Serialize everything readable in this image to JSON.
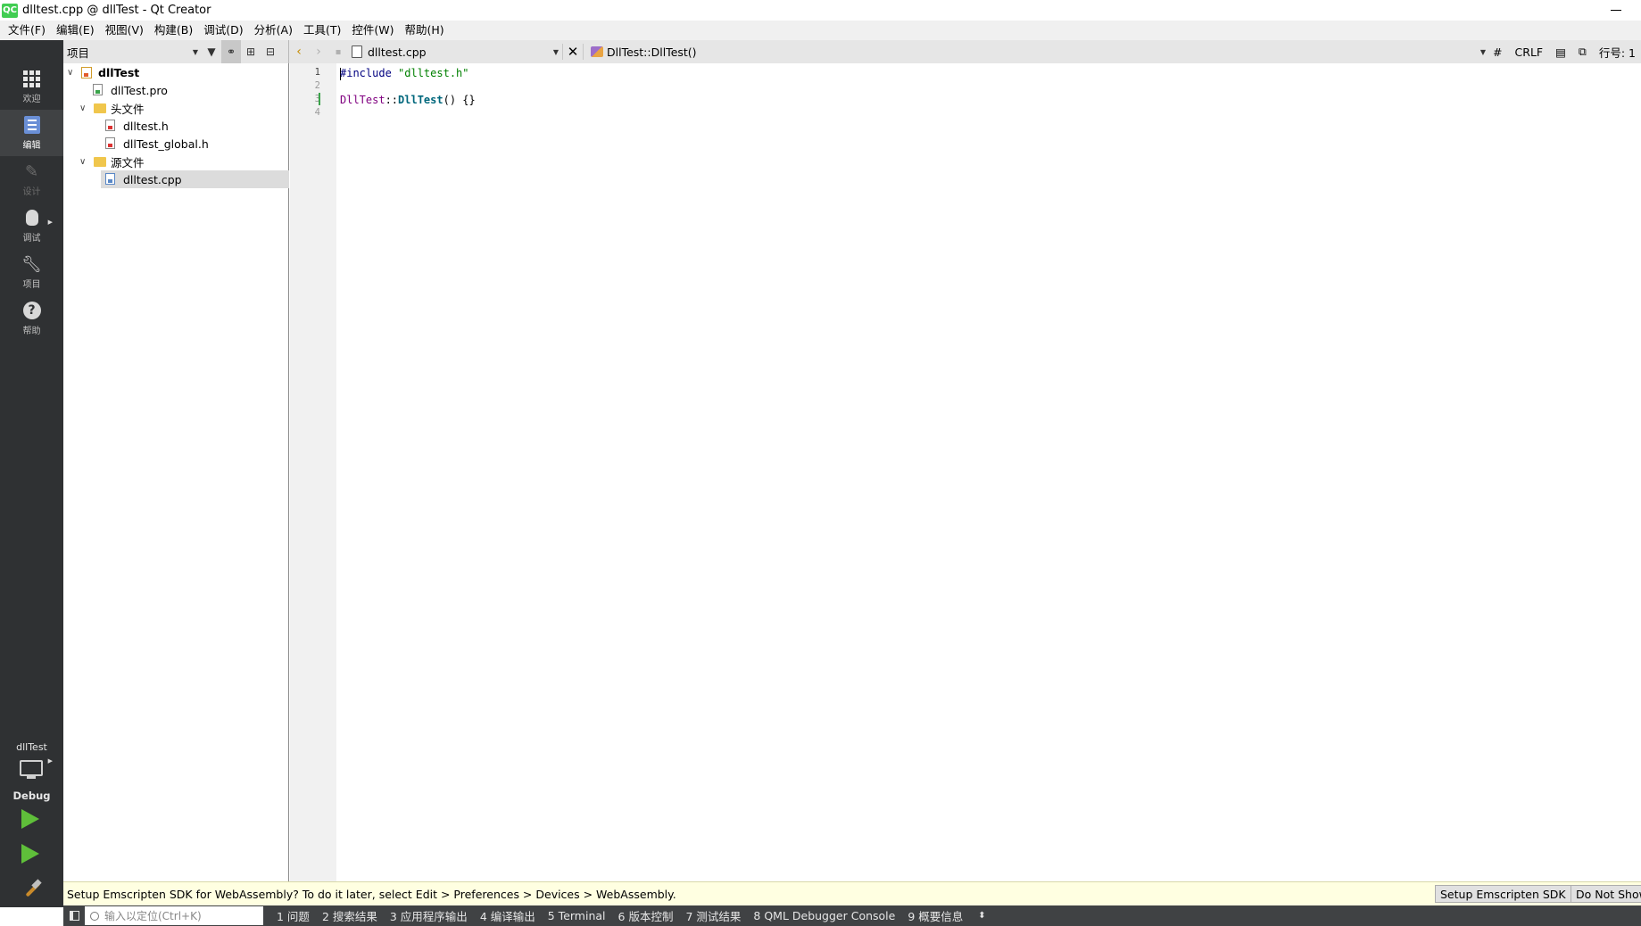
{
  "window": {
    "title": "dlltest.cpp @ dllTest - Qt Creator",
    "logo_text": "QC"
  },
  "menu": [
    "文件(F)",
    "编辑(E)",
    "视图(V)",
    "构建(B)",
    "调试(D)",
    "分析(A)",
    "工具(T)",
    "控件(W)",
    "帮助(H)"
  ],
  "project_toolbar": {
    "view_label": "项目"
  },
  "editor_toolbar": {
    "file": "dlltest.cpp",
    "symbol": "DllTest::DllTest()",
    "hash": "#",
    "line_ending": "CRLF",
    "line_label": "行号: 1"
  },
  "modes": [
    {
      "label": "欢迎",
      "icon": "welcome-grid-icon"
    },
    {
      "label": "编辑",
      "icon": "edit-icon",
      "active": true
    },
    {
      "label": "设计",
      "icon": "design-pencil-icon",
      "disabled": true
    },
    {
      "label": "调试",
      "icon": "debug-bug-icon"
    },
    {
      "label": "项目",
      "icon": "projects-wrench-icon"
    },
    {
      "label": "帮助",
      "icon": "help-icon"
    }
  ],
  "kit": {
    "project": "dllTest",
    "build": "Debug"
  },
  "tree": [
    {
      "label": "dllTest",
      "kind": "project",
      "bold": true
    },
    {
      "label": "dllTest.pro",
      "kind": "pro"
    },
    {
      "label": "头文件",
      "kind": "folder-h"
    },
    {
      "label": "dlltest.h",
      "kind": "h"
    },
    {
      "label": "dllTest_global.h",
      "kind": "h"
    },
    {
      "label": "源文件",
      "kind": "folder-cpp"
    },
    {
      "label": "dlltest.cpp",
      "kind": "cpp",
      "selected": true
    }
  ],
  "code": {
    "line_numbers": [
      "1",
      "2",
      "3",
      "4"
    ],
    "line1_directive": "#include",
    "line1_string": "\"dlltest.h\"",
    "line3_class": "DllTest",
    "line3_sep": "::",
    "line3_fn": "DllTest",
    "line3_rest": "() {}"
  },
  "infobar": {
    "message": "Setup Emscripten SDK for WebAssembly? To do it later, select Edit > Preferences > Devices > WebAssembly.",
    "btn_setup": "Setup Emscripten SDK",
    "btn_dismiss": "Do Not Show Again"
  },
  "output": {
    "locator_placeholder": "输入以定位(Ctrl+K)",
    "tabs": [
      "1  问题",
      "2  搜索结果",
      "3  应用程序输出",
      "4  编译输出",
      "5  Terminal",
      "6  版本控制",
      "7  测试结果",
      "8  QML Debugger Console",
      "9  概要信息"
    ]
  },
  "colors": {
    "sidebar": "#2f3133",
    "run_green": "#5fbf3a",
    "info_bg": "#ffffe1"
  }
}
